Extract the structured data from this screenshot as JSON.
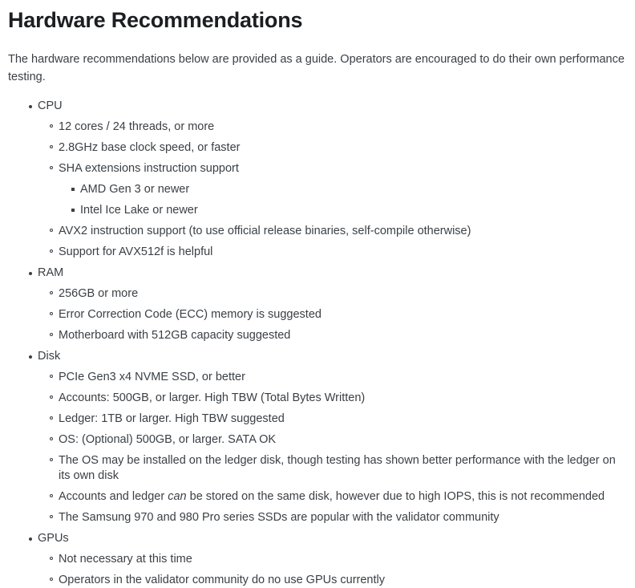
{
  "page": {
    "title": "Hardware Recommendations",
    "intro": "The hardware recommendations below are provided as a guide. Operators are encouraged to do their own performance testing."
  },
  "colors": {
    "heading": "#1c1e21",
    "body_text": "#3b4045",
    "background": "#ffffff"
  },
  "markers": {
    "level1": "filled-disc",
    "level2": "hollow-circle",
    "level3": "filled-square"
  },
  "sections": [
    {
      "label": "CPU",
      "items": [
        {
          "text": "12 cores / 24 threads, or more"
        },
        {
          "text": "2.8GHz base clock speed, or faster"
        },
        {
          "text": "SHA extensions instruction support",
          "children": [
            {
              "text": "AMD Gen 3 or newer"
            },
            {
              "text": "Intel Ice Lake or newer"
            }
          ]
        },
        {
          "text": "AVX2 instruction support (to use official release binaries, self-compile otherwise)"
        },
        {
          "text": "Support for AVX512f is helpful"
        }
      ]
    },
    {
      "label": "RAM",
      "items": [
        {
          "text": "256GB or more"
        },
        {
          "text": "Error Correction Code (ECC) memory is suggested"
        },
        {
          "text": "Motherboard with 512GB capacity suggested"
        }
      ]
    },
    {
      "label": "Disk",
      "items": [
        {
          "text": "PCIe Gen3 x4 NVME SSD, or better"
        },
        {
          "text": "Accounts: 500GB, or larger. High TBW (Total Bytes Written)"
        },
        {
          "text": "Ledger: 1TB or larger. High TBW suggested"
        },
        {
          "text": "OS: (Optional) 500GB, or larger. SATA OK"
        },
        {
          "text": "The OS may be installed on the ledger disk, though testing has shown better performance with the ledger on its own disk"
        },
        {
          "text_before": "Accounts and ledger ",
          "text_italic": "can",
          "text_after": " be stored on the same disk, however due to high IOPS, this is not recommended"
        },
        {
          "text": "The Samsung 970 and 980 Pro series SSDs are popular with the validator community"
        }
      ]
    },
    {
      "label": "GPUs",
      "items": [
        {
          "text": "Not necessary at this time"
        },
        {
          "text": "Operators in the validator community do no use GPUs currently"
        }
      ]
    }
  ]
}
